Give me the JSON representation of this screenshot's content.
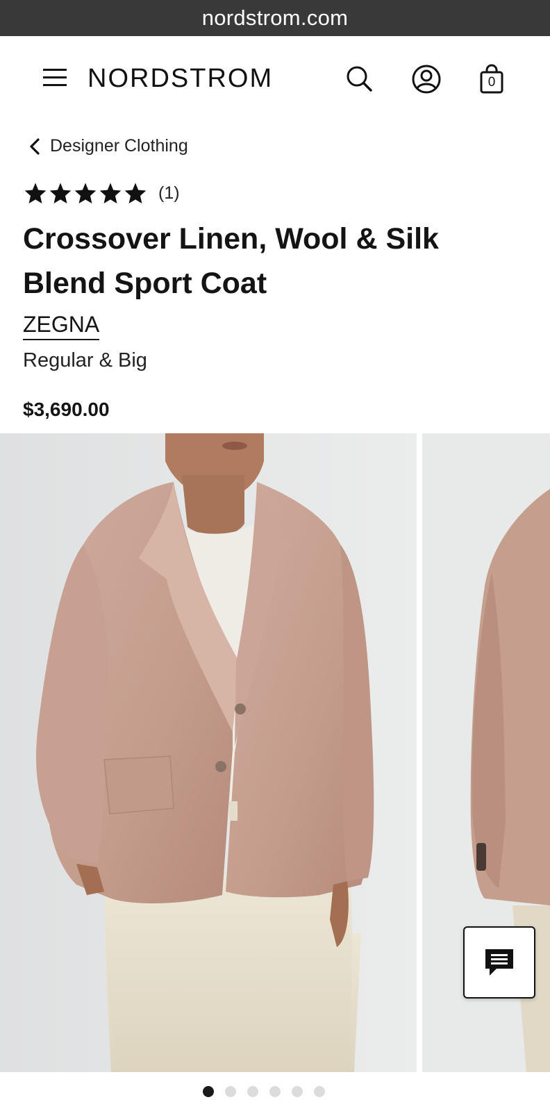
{
  "browser": {
    "url": "nordstrom.com"
  },
  "header": {
    "logo": "NORDSTROM",
    "icons": [
      "menu-icon",
      "search-icon",
      "account-icon",
      "shopping-bag-icon"
    ],
    "bag_count": "0"
  },
  "breadcrumb": {
    "label": "Designer Clothing"
  },
  "product": {
    "rating_stars": 5,
    "review_count": "(1)",
    "title": "Crossover Linen, Wool & Silk Blend Sport Coat",
    "brand": "ZEGNA",
    "fit": "Regular & Big",
    "price": "$3,690.00"
  },
  "gallery": {
    "image_count": 6,
    "active_index": 0,
    "colors": {
      "jacket": "#c9a293",
      "shirt": "#efece6",
      "pants": "#e5decb",
      "background": "#e5e6e7"
    }
  },
  "chat": {
    "icon": "chat-icon"
  }
}
